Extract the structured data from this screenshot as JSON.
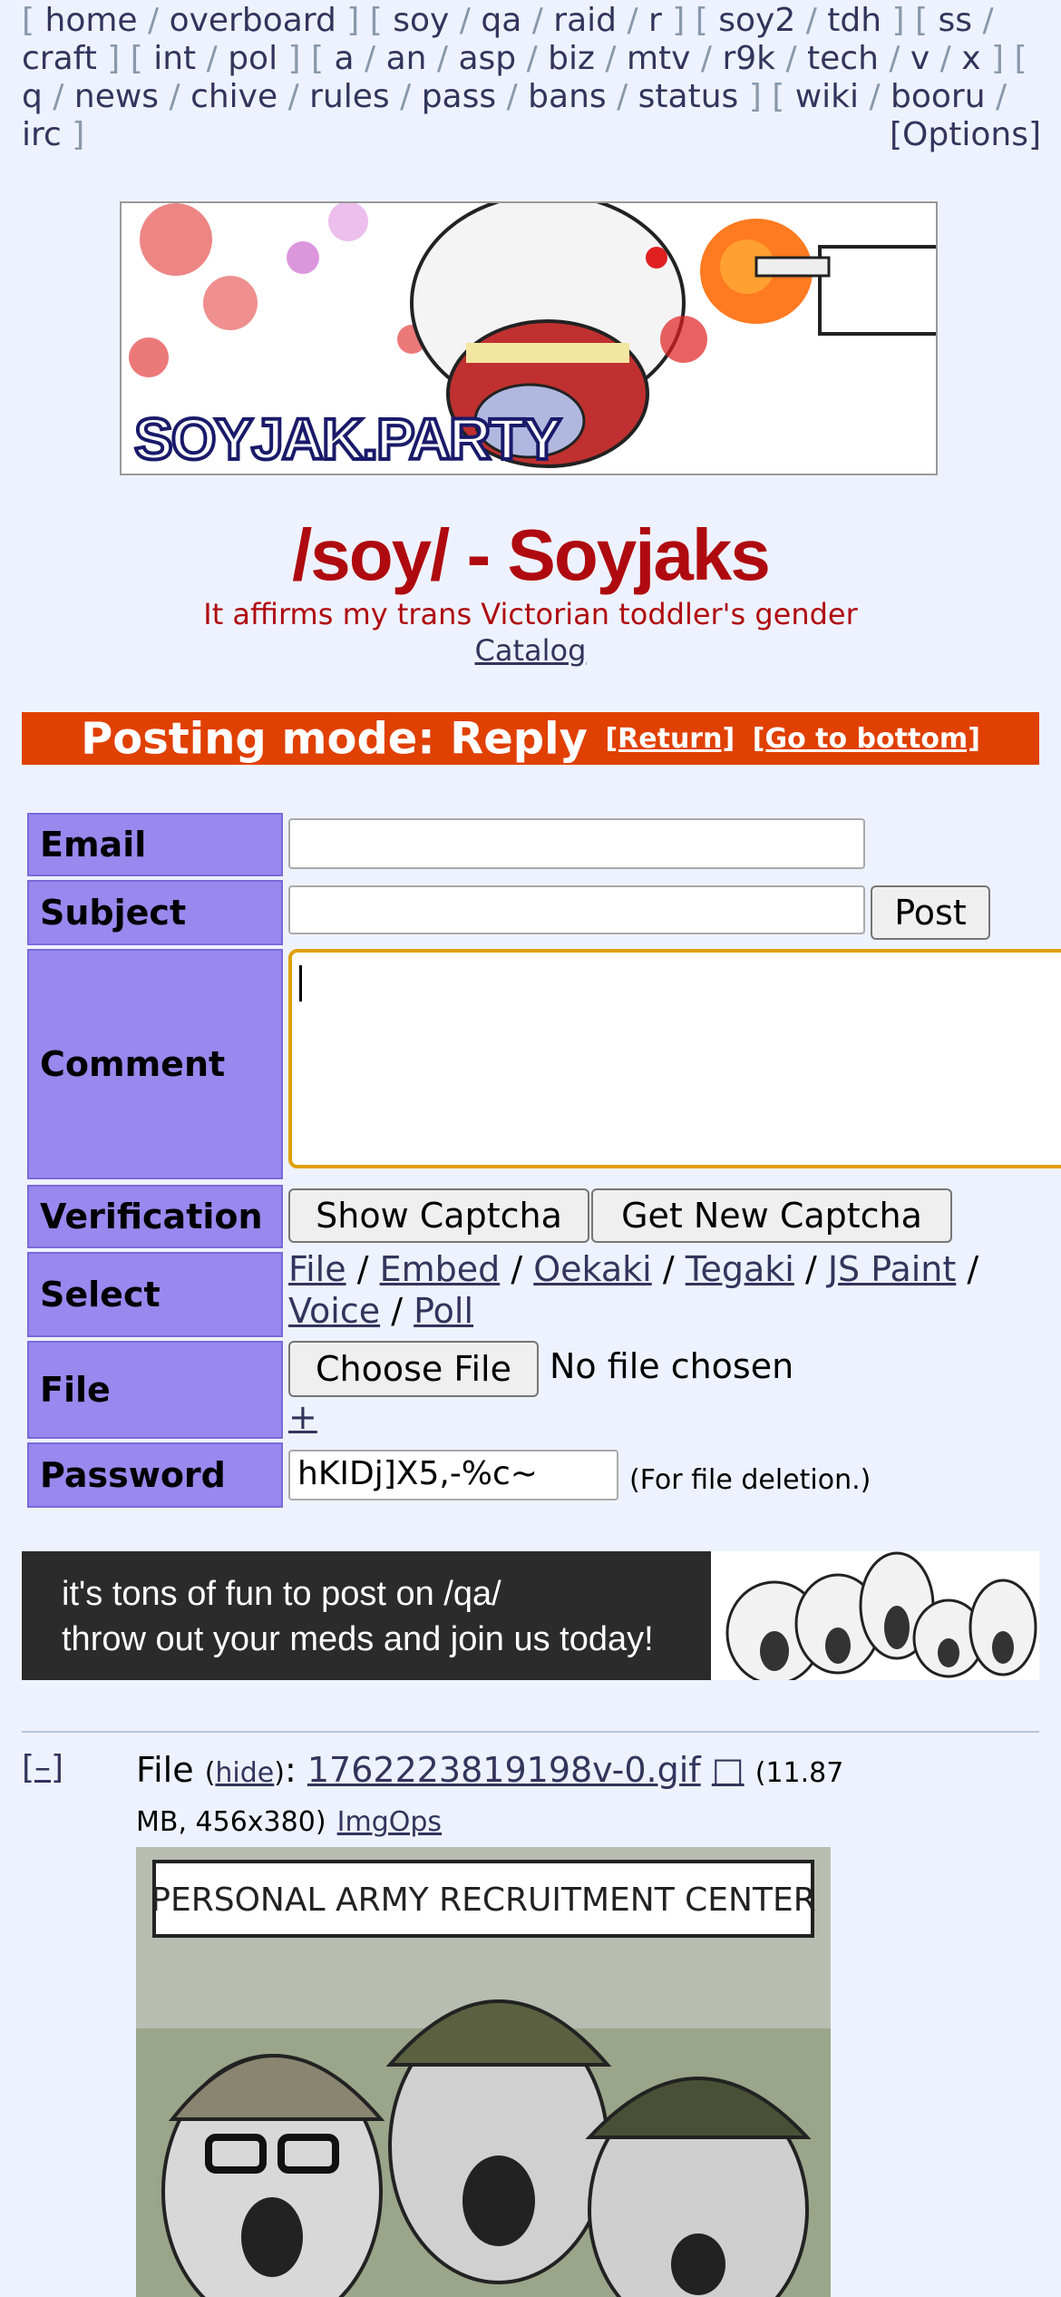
{
  "boardlist": {
    "group1": [
      "home",
      "overboard"
    ],
    "group2": [
      "soy",
      "qa",
      "raid",
      "r"
    ],
    "group3": [
      "soy2",
      "tdh"
    ],
    "group4": [
      "ss",
      "craft"
    ],
    "group5": [
      "int",
      "pol"
    ],
    "group6": [
      "a",
      "an",
      "asp",
      "biz",
      "mtv",
      "r9k",
      "tech",
      "v",
      "x",
      "q",
      "news",
      "chive",
      "rules",
      "pass",
      "bans",
      "status"
    ],
    "group7": [
      "wiki",
      "booru",
      "irc"
    ],
    "options": "[Options]"
  },
  "banner": {
    "text": "SOYJAK.PARTY"
  },
  "header": {
    "title": "/soy/ - Soyjaks",
    "subtitle": "It affirms my trans Victorian toddler's gender",
    "catalog": "Catalog"
  },
  "mode_bar": {
    "text": "Posting mode: Reply",
    "return": "[Return]",
    "bottom": "[Go to bottom]",
    "color": "#e04000"
  },
  "form": {
    "email_label": "Email",
    "email_value": "",
    "subject_label": "Subject",
    "subject_value": "",
    "post_button": "Post",
    "comment_label": "Comment",
    "comment_value": "",
    "verification_label": "Verification",
    "show_captcha": "Show Captcha",
    "new_captcha": "Get New Captcha",
    "select_label": "Select",
    "select_options": [
      "File",
      "Embed",
      "Oekaki",
      "Tegaki",
      "JS Paint",
      "Voice",
      "Poll"
    ],
    "file_label": "File",
    "choose_file": "Choose File",
    "no_file": "No file chosen",
    "add_file": "+",
    "password_label": "Password",
    "password_value": "hKIDj]X5,-%c~",
    "password_hint": "(For file deletion.)",
    "label_color": "#9988ee"
  },
  "ad": {
    "line1": "it's tons of fun to post on /qa/",
    "line2": "throw out your meds and join us today!"
  },
  "thread": {
    "collapse": "[–]",
    "file_prefix": "File",
    "hide": "hide",
    "filename": "1762223819198v-0.gif",
    "download_icon": "download-icon",
    "meta": "(11.87 MB, 456x380)",
    "imgops": "ImgOps",
    "image_caption": "PERSONAL ARMY RECRUITMENT CENTER"
  }
}
